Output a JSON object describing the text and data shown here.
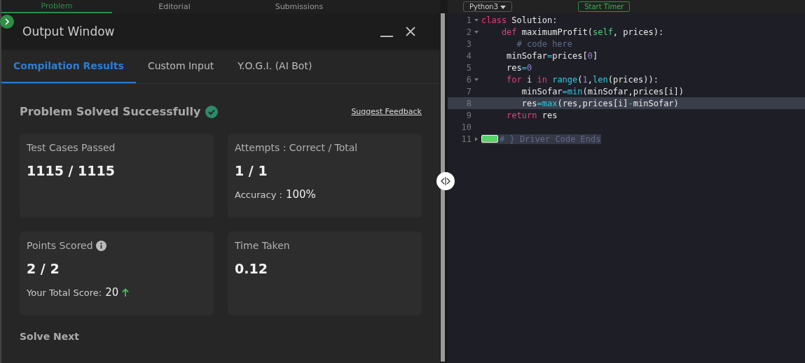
{
  "top_tabs": [
    {
      "label": "Problem",
      "selected": true
    },
    {
      "label": "Editorial",
      "selected": false
    },
    {
      "label": "Submissions",
      "selected": false
    }
  ],
  "editor_toolbar": {
    "language": "Python3",
    "timer_button": "Start Timer"
  },
  "output_window": {
    "title": "Output Window",
    "tabs": [
      {
        "label": "Compilation Results",
        "selected": true
      },
      {
        "label": "Custom Input",
        "selected": false
      },
      {
        "label": "Y.O.G.I. (AI Bot)",
        "selected": false
      }
    ],
    "status": "Problem Solved Successfully",
    "feedback_link": "Suggest Feedback",
    "cards": [
      {
        "title": "Test Cases Passed",
        "value": "1115 / 1115",
        "info": false
      },
      {
        "title": "Attempts : Correct / Total",
        "value": "1 / 1",
        "sub_label": "Accuracy :",
        "sub_value": "100%",
        "info": false
      },
      {
        "title": "Points Scored",
        "value": "2 / 2",
        "sub_label": "Your Total Score:",
        "sub_value": "20",
        "trend_up": true,
        "info": true
      },
      {
        "title": "Time Taken",
        "value": "0.12",
        "info": false
      }
    ],
    "next_heading": "Solve Next"
  },
  "code_lines": [
    {
      "number": "1",
      "foldable": true,
      "folded": false,
      "highlighted": false,
      "tokens": [
        {
          "t": "class",
          "kind": "keyword"
        },
        {
          "t": " Solution:",
          "kind": "plain"
        }
      ]
    },
    {
      "number": "2",
      "foldable": true,
      "folded": false,
      "highlighted": false,
      "tokens": [
        {
          "t": "    def",
          "kind": "keyword"
        },
        {
          "t": " maximumProfit(",
          "kind": "plain"
        },
        {
          "t": "self",
          "kind": "builtin"
        },
        {
          "t": ", prices):",
          "kind": "plain"
        }
      ]
    },
    {
      "number": "3",
      "highlighted": false,
      "tokens": [
        {
          "t": "       # code here",
          "kind": "comment"
        }
      ]
    },
    {
      "number": "4",
      "highlighted": false,
      "tokens": [
        {
          "t": "     minSofar",
          "kind": "plain"
        },
        {
          "t": "=",
          "kind": "operator"
        },
        {
          "t": "prices[",
          "kind": "plain"
        },
        {
          "t": "0",
          "kind": "number"
        },
        {
          "t": "]",
          "kind": "plain"
        }
      ]
    },
    {
      "number": "5",
      "highlighted": false,
      "tokens": [
        {
          "t": "     res",
          "kind": "plain"
        },
        {
          "t": "=",
          "kind": "operator"
        },
        {
          "t": "0",
          "kind": "number"
        }
      ]
    },
    {
      "number": "6",
      "foldable": true,
      "folded": false,
      "highlighted": false,
      "tokens": [
        {
          "t": "     for",
          "kind": "keyword"
        },
        {
          "t": " i ",
          "kind": "plain"
        },
        {
          "t": "in",
          "kind": "keyword"
        },
        {
          "t": " range",
          "kind": "function"
        },
        {
          "t": "(",
          "kind": "plain"
        },
        {
          "t": "1",
          "kind": "number"
        },
        {
          "t": ",",
          "kind": "plain"
        },
        {
          "t": "len",
          "kind": "function"
        },
        {
          "t": "(prices)):",
          "kind": "plain"
        }
      ]
    },
    {
      "number": "7",
      "highlighted": false,
      "tokens": [
        {
          "t": "        minSofar",
          "kind": "plain"
        },
        {
          "t": "=",
          "kind": "operator"
        },
        {
          "t": "min",
          "kind": "function"
        },
        {
          "t": "(minSofar,prices[i])",
          "kind": "plain"
        }
      ]
    },
    {
      "number": "8",
      "highlighted": true,
      "tokens": [
        {
          "t": "        res",
          "kind": "plain"
        },
        {
          "t": "=",
          "kind": "operator"
        },
        {
          "t": "max",
          "kind": "function"
        },
        {
          "t": "(res,prices[i]",
          "kind": "plain"
        },
        {
          "t": "-",
          "kind": "operator"
        },
        {
          "t": "minSofar)",
          "kind": "plain"
        }
      ]
    },
    {
      "number": "9",
      "highlighted": false,
      "tokens": [
        {
          "t": "     return",
          "kind": "keyword"
        },
        {
          "t": " res",
          "kind": "plain"
        }
      ]
    },
    {
      "number": "10",
      "highlighted": false
    },
    {
      "number": "11",
      "foldable": true,
      "folded": true,
      "highlighted": false,
      "tokens": [
        {
          "t": "# } Driver Code Ends",
          "kind": "comment"
        }
      ]
    }
  ]
}
